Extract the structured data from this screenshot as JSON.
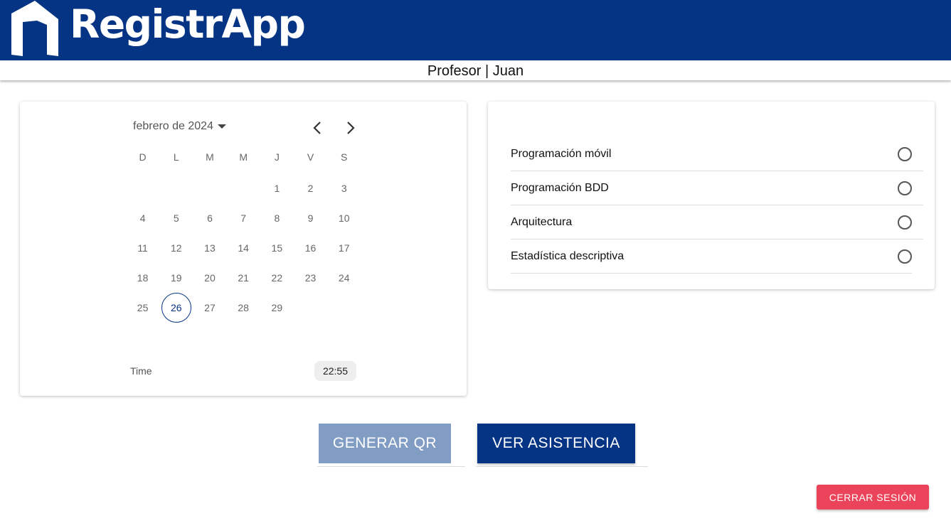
{
  "app": {
    "name": "RegistrApp",
    "brand_color": "#053484"
  },
  "subheader": {
    "text": "Profesor | Juan"
  },
  "calendar": {
    "month_label": "febrero de 2024",
    "weekdays": [
      "D",
      "L",
      "M",
      "M",
      "J",
      "V",
      "S"
    ],
    "days": [
      "",
      "",
      "",
      "",
      "1",
      "2",
      "3",
      "4",
      "5",
      "6",
      "7",
      "8",
      "9",
      "10",
      "11",
      "12",
      "13",
      "14",
      "15",
      "16",
      "17",
      "18",
      "19",
      "20",
      "21",
      "22",
      "23",
      "24",
      "25",
      "26",
      "27",
      "28",
      "29",
      "",
      ""
    ],
    "selected_day": "26",
    "time_label": "Time",
    "time_value": "22:55"
  },
  "subjects": {
    "items": [
      {
        "label": "Programación móvil",
        "selected": false
      },
      {
        "label": "Programación BDD",
        "selected": false
      },
      {
        "label": "Arquitectura",
        "selected": false
      },
      {
        "label": "Estadística descriptiva",
        "selected": false
      }
    ]
  },
  "actions": {
    "generate_qr": "GENERAR QR",
    "view_attendance": "VER ASISTENCIA",
    "logout": "CERRAR SESIÓN",
    "logout_color": "#eb445a",
    "generate_qr_color": "#829dc4"
  }
}
